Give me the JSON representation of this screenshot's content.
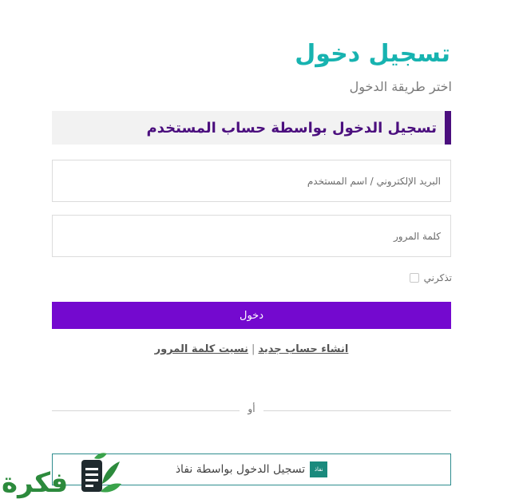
{
  "header": {
    "title": "تسجيل دخول",
    "subtitle": "اختر طريقة الدخول"
  },
  "section": {
    "title": "تسجيل الدخول بواسطة حساب المستخدم"
  },
  "form": {
    "email_placeholder": "البريد الإلكتروني / اسم المستخدم",
    "password_placeholder": "كلمة المرور",
    "remember_label": "تذكرني",
    "login_label": "دخول"
  },
  "links": {
    "create_account": "انشاء حساب جديد",
    "separator": "|",
    "forgot_password": "نسيت كلمة المرور"
  },
  "divider": {
    "or_label": "أو"
  },
  "nafath": {
    "label": "تسجيل الدخول بواسطة نفاذ",
    "logo_text": "نفاذ"
  },
  "watermark": {
    "text": "فكرة"
  },
  "colors": {
    "title": "#17b3b0",
    "section_accent": "#4b0f7e",
    "login_button": "#7409cf",
    "nafath_border": "#2f8d8f",
    "watermark_green": "#2c8a3c"
  }
}
